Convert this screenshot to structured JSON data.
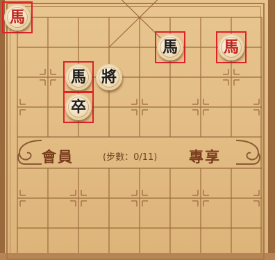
{
  "board": {
    "river_left": "會員",
    "river_right": "專享",
    "step_prefix": "(步數：",
    "step_count": "0/11",
    "step_suffix": ")"
  },
  "pieces": [
    {
      "name": "red-horse",
      "char": "馬",
      "side": "red",
      "file": 0,
      "rank": 0,
      "highlighted": true
    },
    {
      "name": "black-horse",
      "char": "馬",
      "side": "black",
      "file": 5,
      "rank": 1,
      "highlighted": true
    },
    {
      "name": "red-horse",
      "char": "馬",
      "side": "red",
      "file": 7,
      "rank": 1,
      "highlighted": true
    },
    {
      "name": "black-horse",
      "char": "馬",
      "side": "black",
      "file": 2,
      "rank": 2,
      "highlighted": true
    },
    {
      "name": "black-general",
      "char": "將",
      "side": "black",
      "file": 3,
      "rank": 2,
      "highlighted": false
    },
    {
      "name": "black-soldier",
      "char": "卒",
      "side": "black",
      "file": 2,
      "rank": 3,
      "highlighted": true
    }
  ],
  "colors": {
    "board": "#e3bd86",
    "line": "#9c6b3e",
    "red_piece_text": "#c0241d",
    "black_piece_text": "#1d1d1d",
    "highlight": "#e0202a"
  }
}
